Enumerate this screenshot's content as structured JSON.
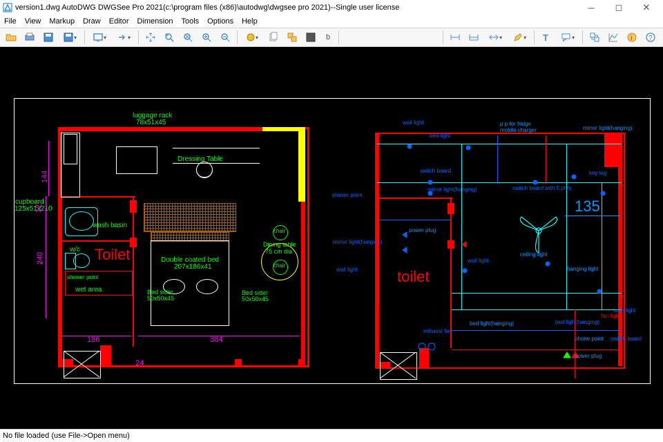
{
  "title": "version1.dwg AutoDWG DWGSee Pro 2021(c:\\program files (x86)\\autodwg\\dwgsee pro 2021)--Single user license",
  "menu": [
    "File",
    "View",
    "Markup",
    "Draw",
    "Editor",
    "Dimension",
    "Tools",
    "Options",
    "Help"
  ],
  "status": "No file loaded (use File->Open menu)",
  "draw": {
    "left": {
      "cupboard": "cupboard",
      "cupboard_dim": "125x51x210",
      "luggage": "luggage rack",
      "luggage_dim": "78x51x45",
      "dressing": "Dressing Table",
      "washbasin": "wash basin",
      "wc": "w/c",
      "toilet": "Toilet",
      "bed": "Double coated bed",
      "bed_dim": "207x186x41",
      "dining": "Dining table",
      "dining_dim": "75 cm dia",
      "chair": "chair",
      "bedsider_l": "Bed sider",
      "bedsider_l_dim": "50x50x45",
      "bedsider_r": "Bed sider",
      "bedsider_r_dim": "50x50x45",
      "shower": "shower point",
      "wet": "wet area",
      "dim_144": "144",
      "dim_12": "12",
      "dim_240": "240",
      "dim_186": "186",
      "dim_384": "384",
      "dim_24": "24"
    },
    "right": {
      "toilet": "toilet",
      "switch_board": "switch board",
      "mirror_light": "mirror light(hanging)",
      "mirror_light2": "mirror light(hanging)",
      "wall_light": "wall light",
      "wall_light2": "wall light",
      "bed_light": "bed light",
      "pp_fridge": "p p for fridge\nmobile charger",
      "key_tag": "key tag",
      "switch_board5": "switch board with 5 pt?s",
      "dim_135": "135",
      "ceiling": "ceiling light",
      "hanging": "hanging light",
      "shaver": "shaver point",
      "power": "power plug",
      "power2": "power plug",
      "exhaust": "exhaust fan",
      "bed_light_hang": "bed light(hanging)",
      "bed_light_hang2": "bed light(hanging)",
      "fan_light": "fan light",
      "phone": "phone point",
      "switch_board2": "switch board",
      "tube": "tube light"
    }
  }
}
